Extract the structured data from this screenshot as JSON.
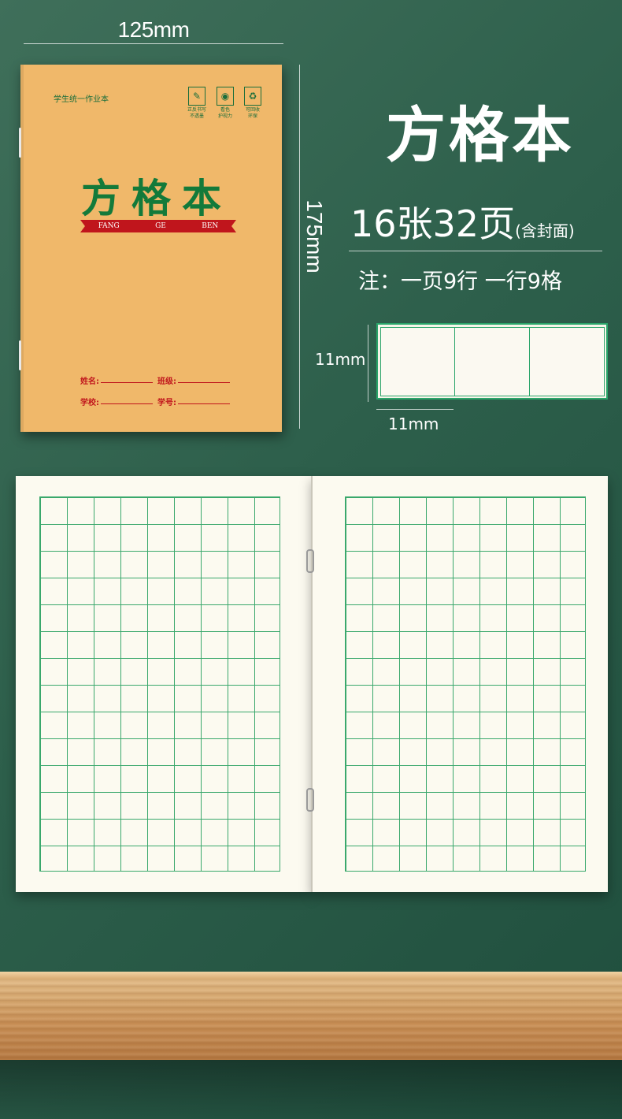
{
  "dimensions": {
    "width_label": "125mm",
    "height_label": "175mm",
    "cell_height_label": "11mm",
    "cell_width_label": "11mm"
  },
  "cover": {
    "series": "学生统一作业本",
    "certifications": [
      {
        "icon": "leaf-icon",
        "symbol": "✎",
        "caption": "正反书写\n不透墨"
      },
      {
        "icon": "eye-icon",
        "symbol": "◉",
        "caption": "看色\n护视力"
      },
      {
        "icon": "recycle-icon",
        "symbol": "♻",
        "caption": "可回收\n环保"
      }
    ],
    "title": "方格本",
    "band": [
      "FANG",
      "GE",
      "BEN"
    ],
    "fields": [
      {
        "label": "姓名:",
        "label2": "班级:"
      },
      {
        "label": "学校:",
        "label2": "学号:"
      }
    ]
  },
  "info": {
    "title": "方格本",
    "spec_main": "16张32页",
    "spec_sub": "(含封面)",
    "note": "注：一页9行 一行9格"
  },
  "colors": {
    "background": "#2d5f4b",
    "cover": "#f0b86a",
    "cover_text": "#137a3a",
    "band": "#c0151c",
    "grid_line": "#3aa86c",
    "paper": "#fcfaf0"
  },
  "notebook": {
    "columns": 9,
    "rows": 14
  }
}
